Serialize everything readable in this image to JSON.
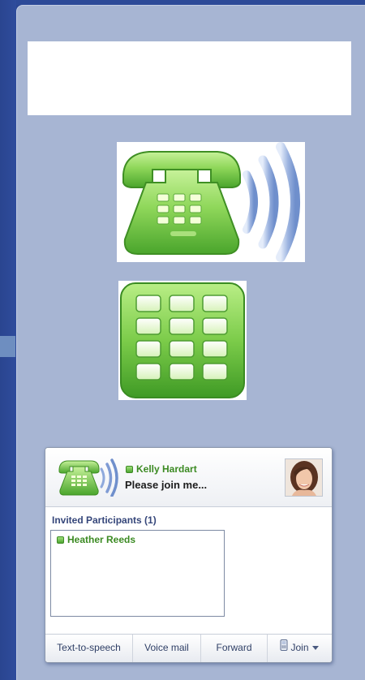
{
  "window": {
    "background_color": "#a7b5d3",
    "frame_color": "#2b4693"
  },
  "illustrations": {
    "large_phone": "green-telephone-with-sound-waves-icon",
    "keypad": "green-keypad-icon"
  },
  "notification": {
    "icon": "green-telephone-with-sound-waves-icon",
    "caller": {
      "name": "Kelly Hardart",
      "status": "online",
      "status_color": "#4ea632"
    },
    "message": "Please join me...",
    "avatar": "caller-avatar-photo",
    "participants": {
      "title": "Invited Participants (1)",
      "items": [
        {
          "name": "Heather Reeds",
          "status": "online"
        }
      ]
    },
    "actions": {
      "text_to_speech": "Text-to-speech",
      "voice_mail": "Voice mail",
      "forward": "Forward",
      "join": "Join"
    }
  }
}
